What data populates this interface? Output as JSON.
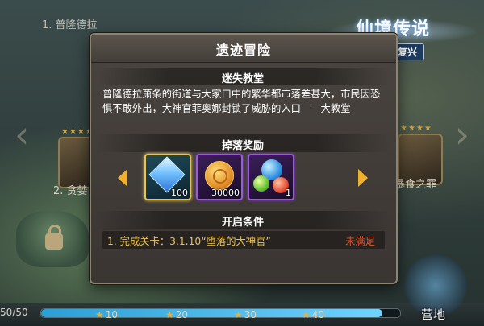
{
  "background": {
    "stage_label": "1. 普隆德拉",
    "left_card_name": "2. 贪婪",
    "right_card_name": "暴食之罪",
    "stars": "★★★★"
  },
  "logo": {
    "title": "仙境传说",
    "subtitle": "复兴"
  },
  "dialog": {
    "title": "遗迹冒险",
    "section_title": "迷失教堂",
    "description": "普隆德拉萧条的街道与大家口中的繁华都市落差甚大，市民因恐惧不敢外出，大神官菲奥娜封锁了威胁的入口——大教堂",
    "rewards_title": "掉落奖励",
    "rewards": [
      {
        "icon": "blue-crystal-icon",
        "qty": "100"
      },
      {
        "icon": "gold-coin-icon",
        "qty": "30000"
      },
      {
        "icon": "elemental-orbs-icon",
        "qty": "1"
      }
    ],
    "condition_title": "开启条件",
    "conditions": [
      {
        "text": "1. 完成关卡：3.1.10“堕落的大神官”",
        "status": "未满足"
      }
    ]
  },
  "footer": {
    "progress_text": "50/50",
    "progress_fraction": 0.95,
    "milestones": [
      "10",
      "20",
      "30",
      "40"
    ],
    "camp_label": "营地"
  },
  "colors": {
    "accent_gold": "#f0c34c",
    "status_red": "#e2542e",
    "rare_frame": "#e6c557",
    "epic_frame": "#9d5bd8"
  }
}
